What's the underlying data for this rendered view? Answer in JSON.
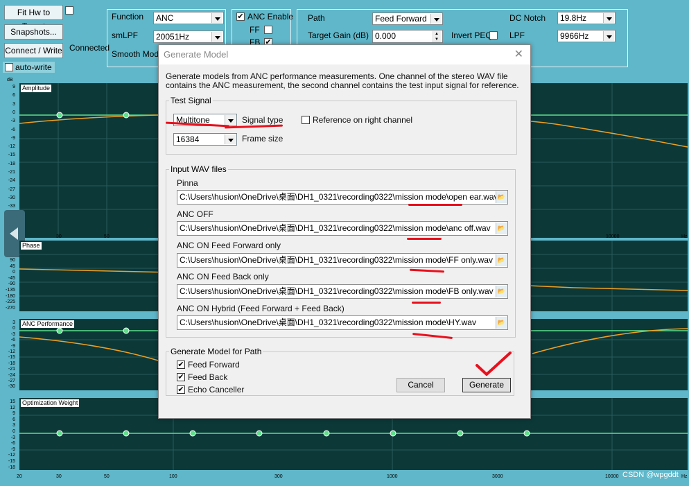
{
  "toolbar": {
    "fit_btn": "Fit Hw to Target",
    "snapshots_btn": "Snapshots...",
    "connect_btn": "Connect / Write",
    "connected_status": "Connected",
    "autowrite_label": "auto-write",
    "function_label": "Function",
    "function_value": "ANC",
    "smlpf_label": "smLPF",
    "smlpf_value": "20051Hz",
    "smooth_label": "Smooth Model",
    "anc_enable_label": "ANC Enable",
    "ff_label": "FF",
    "fb_label": "FB",
    "path_label": "Path",
    "path_value": "Feed Forward",
    "target_gain_label": "Target Gain (dB)",
    "target_gain_value": "0.000",
    "invert_peq_label": "Invert PEQ",
    "dc_notch_label": "DC Notch",
    "dc_notch_value": "19.8Hz",
    "lpf_label": "LPF",
    "lpf_value": "9966Hz"
  },
  "plots": {
    "amplitude_title": "Amplitude",
    "phase_title": "Phase",
    "anc_title": "ANC Performance",
    "weight_title": "Optimization Weight",
    "db_unit": "dB",
    "hz_unit": "Hz",
    "amp_ticks": [
      "9",
      "6",
      "3",
      "0",
      "-3",
      "-6",
      "-9",
      "-12",
      "-15",
      "-18",
      "-21",
      "-24",
      "-27",
      "-30",
      "-33"
    ],
    "phase_ticks": [
      "90",
      "45",
      "0",
      "-45",
      "-90",
      "-135",
      "-180",
      "-225",
      "-270"
    ],
    "anc_ticks": [
      "3",
      "0",
      "-3",
      "-6",
      "-9",
      "-12",
      "-15",
      "-18",
      "-21",
      "-24",
      "-27",
      "-30"
    ],
    "weight_ticks": [
      "15",
      "12",
      "9",
      "6",
      "3",
      "0",
      "-3",
      "-6",
      "-9",
      "-12",
      "-15",
      "-18"
    ],
    "x_labels": [
      "20",
      "30",
      "50",
      "100",
      "300",
      "1000",
      "3000",
      "10000"
    ],
    "amp_x_labels": [
      "30",
      "50",
      "10000"
    ]
  },
  "dialog": {
    "title": "Generate Model",
    "close": "✕",
    "description": "Generate models from ANC performance measurements. One channel of the stereo WAV file contains the ANC measurement, the second channel contains the test input signal for reference.",
    "test_signal_group": "Test Signal",
    "signal_type_value": "Multitone",
    "signal_type_label": "Signal type",
    "reference_label": "Reference on right channel",
    "frame_size_value": "16384",
    "frame_size_label": "Frame size",
    "input_wav_group": "Input WAV files",
    "files": [
      {
        "label": "Pinna",
        "path": "C:\\Users\\husion\\OneDrive\\桌面\\DH1_0321\\recording0322\\mission mode\\open ear.wav"
      },
      {
        "label": "ANC OFF",
        "path": "C:\\Users\\husion\\OneDrive\\桌面\\DH1_0321\\recording0322\\mission mode\\anc off.wav"
      },
      {
        "label": "ANC ON Feed Forward only",
        "path": "C:\\Users\\husion\\OneDrive\\桌面\\DH1_0321\\recording0322\\mission mode\\FF only.wav"
      },
      {
        "label": "ANC ON Feed Back only",
        "path": "C:\\Users\\husion\\OneDrive\\桌面\\DH1_0321\\recording0322\\mission mode\\FB only.wav"
      },
      {
        "label": "ANC ON Hybrid (Feed Forward + Feed Back)",
        "path": "C:\\Users\\husion\\OneDrive\\桌面\\DH1_0321\\recording0322\\mission mode\\HY.wav"
      }
    ],
    "generate_group": "Generate Model for Path",
    "ff_check": "Feed Forward",
    "fb_check": "Feed Back",
    "echo_check": "Echo Canceller",
    "cancel_btn": "Cancel",
    "generate_btn": "Generate"
  },
  "watermark": "CSDN @wpgddt",
  "colors": {
    "background": "#5fb7c9",
    "plot_bg": "#0c3838",
    "curve": "#f0a020",
    "marker": "#5ee08a",
    "annotation": "#e8101c"
  }
}
